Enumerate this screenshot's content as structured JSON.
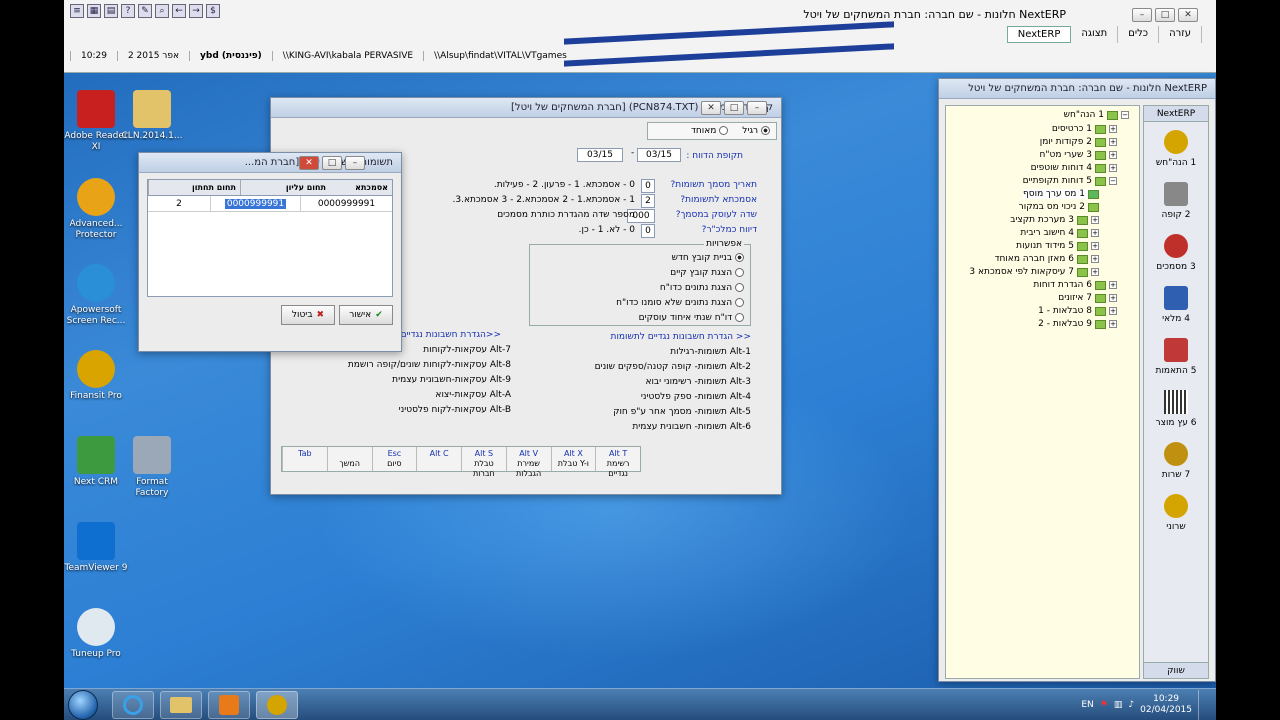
{
  "top": {
    "title": "NextERP חלונות  -  שם חברה: חברת המשחקים של ויטל",
    "menu": [
      "NextERP",
      "תצוגה",
      "כלים",
      "עזרה"
    ],
    "status": [
      "10:29",
      "2 אפר 2015",
      "ybd (פיננסית)",
      "\\\\KING-AVI\\kabala  PERVASIVE",
      "\\\\Alsup\\findat\\VITAL\\VTgames"
    ]
  },
  "desktop": [
    {
      "label": "Adobe Reader XI",
      "color": "#c8201f"
    },
    {
      "label": "CLN.2014.1...",
      "color": "#e3c36a"
    },
    {
      "label": "Advanced... Protector",
      "color": "#e8a317"
    },
    {
      "label": "Apowersoft Screen Rec...",
      "color": "#2b8fd8"
    },
    {
      "label": "Finansit Pro",
      "color": "#d9a400"
    },
    {
      "label": "Next CRM",
      "color": "#3e9a3e"
    },
    {
      "label": "Format Factory",
      "color": "#9aa8b8"
    },
    {
      "label": "TeamViewer 9",
      "color": "#0e6fd0"
    },
    {
      "label": "Tuneup Pro",
      "color": "#e0e8f0"
    }
  ],
  "main_window": {
    "title": "קובץ דיווח מע\"מ (PCN874.TXT) [חברת המשחקים של ויטל]",
    "radio_regular": "רגיל",
    "radio_combined": "מאוחד",
    "period_label": "תקופת הדווח :",
    "period_from": "03/15",
    "period_to": "03/15",
    "rows": [
      {
        "label": "תאריך מסמך תשומות?",
        "value": "0",
        "desc": "0 - אסמכתא. 1 - פרעון. 2 - פעילות."
      },
      {
        "label": "אסמכתא לתשומות?",
        "value": "2",
        "desc": "1 - אסמכתא.1 - 2 אסמכתא.2 - 3 אסמכתא.3."
      },
      {
        "label": "שדה לעוסק במסמך?",
        "value": "000",
        "desc": "מספר שדה מהגדרת כותרת מסמכים"
      },
      {
        "label": "דיווח כמלכ\"ר?",
        "value": "0",
        "desc": "0 - לא. 1 - כן."
      }
    ],
    "options_title": "אפשרויות",
    "options": [
      "בניית קובץ חדש",
      "הצגת קובץ קיים",
      "הצגת נתונים כדו\"ח",
      "הצגת נתונים שלא סומנו כדו\"ח",
      "דו\"ח שנתי איחוד עוסקים"
    ],
    "link_inputs": "<< הגדרת חשבונות נגדיים לתשומות",
    "link_outputs": "<<הגדרת חשבונות נגדיים",
    "alt_right": [
      "Alt-1 תשומות-רגילות",
      "Alt-2 תשומות- קופה קטנה/ספקים שונים",
      "Alt-3 תשומות- רשימוני יבוא",
      "Alt-4 תשומות- ספק פלסטיני",
      "Alt-5 תשומות- מסמך אחר ע\"פ חוק",
      "Alt-6 תשומות- חשבונית עצמית"
    ],
    "alt_left": [
      "Alt-7 עסקאות-לקוחות",
      "Alt-8 עסקאות-לקוחות שונים/קופה רושמת",
      "Alt-9 עסקאות-חשבונית עצמית",
      "Alt-A עסקאות-יצוא",
      "Alt-B עסקאות-לקוח פלסטיני"
    ],
    "funckeys": [
      {
        "key": "Alt T",
        "label": "רשימת נגדיים"
      },
      {
        "key": "Alt X",
        "label": "טבלת Y-ו"
      },
      {
        "key": "Alt V",
        "label": "שמירת הגבלות"
      },
      {
        "key": "Alt S",
        "label": "טבלת חברות"
      },
      {
        "key": "Alt C",
        "label": ""
      },
      {
        "key": "Esc",
        "label": "סיום"
      },
      {
        "key": "",
        "label": "המשך"
      },
      {
        "key": "Tab",
        "label": ""
      }
    ]
  },
  "small_window": {
    "title": "תשומות- רשימוני יבוא [חברת המ...",
    "headers": [
      "תחום תחתון",
      "תחום עליון",
      "אסמכתא"
    ],
    "row": [
      "0000999991",
      "0000999991",
      "2"
    ],
    "ok_label": "אישור",
    "cancel_label": "ביטול"
  },
  "right_panel": {
    "title": "NextERP חלונות  -  שם חברה: חברת המשחקים של ויטל",
    "tab": "NextERP",
    "tree": [
      "1 הנה\"חש",
      "1 כרטיסים",
      "2 פקודות יומן",
      "3 שערי מט\"ח",
      "4 דוחות שוטפים",
      "5 דוחות תקופתיים",
      "1 מס ערך מוסף",
      "2 ניכוי מס במקור",
      "3 מערכת תקציב",
      "4 חישוב ריבית",
      "5 מידוד תנועות",
      "6 מאזן חברה מאוחד",
      "7 עיסקאות לפי אסמכתא 3",
      "6 הגדרת דוחות",
      "7 איזונים",
      "8 טבלאות - 1",
      "9 טבלאות - 2"
    ],
    "nav": [
      {
        "label": "1 הנה\"חש",
        "color": "#d4a400"
      },
      {
        "label": "2 קופה",
        "color": "#888"
      },
      {
        "label": "3 מסמכים",
        "color": "#c0302a"
      },
      {
        "label": "4 מלאי",
        "color": "#2e5fb0"
      },
      {
        "label": "5 התאמות",
        "color": "#c03838"
      },
      {
        "label": "6 עץ מוצר",
        "color": "#333"
      },
      {
        "label": "7 שרות",
        "color": "#c09010"
      },
      {
        "label": "שרוני",
        "color": "#d4a400"
      }
    ],
    "footer": "שווק"
  },
  "taskbar": {
    "lang": "EN",
    "time": "10:29",
    "date": "02/04/2015"
  }
}
